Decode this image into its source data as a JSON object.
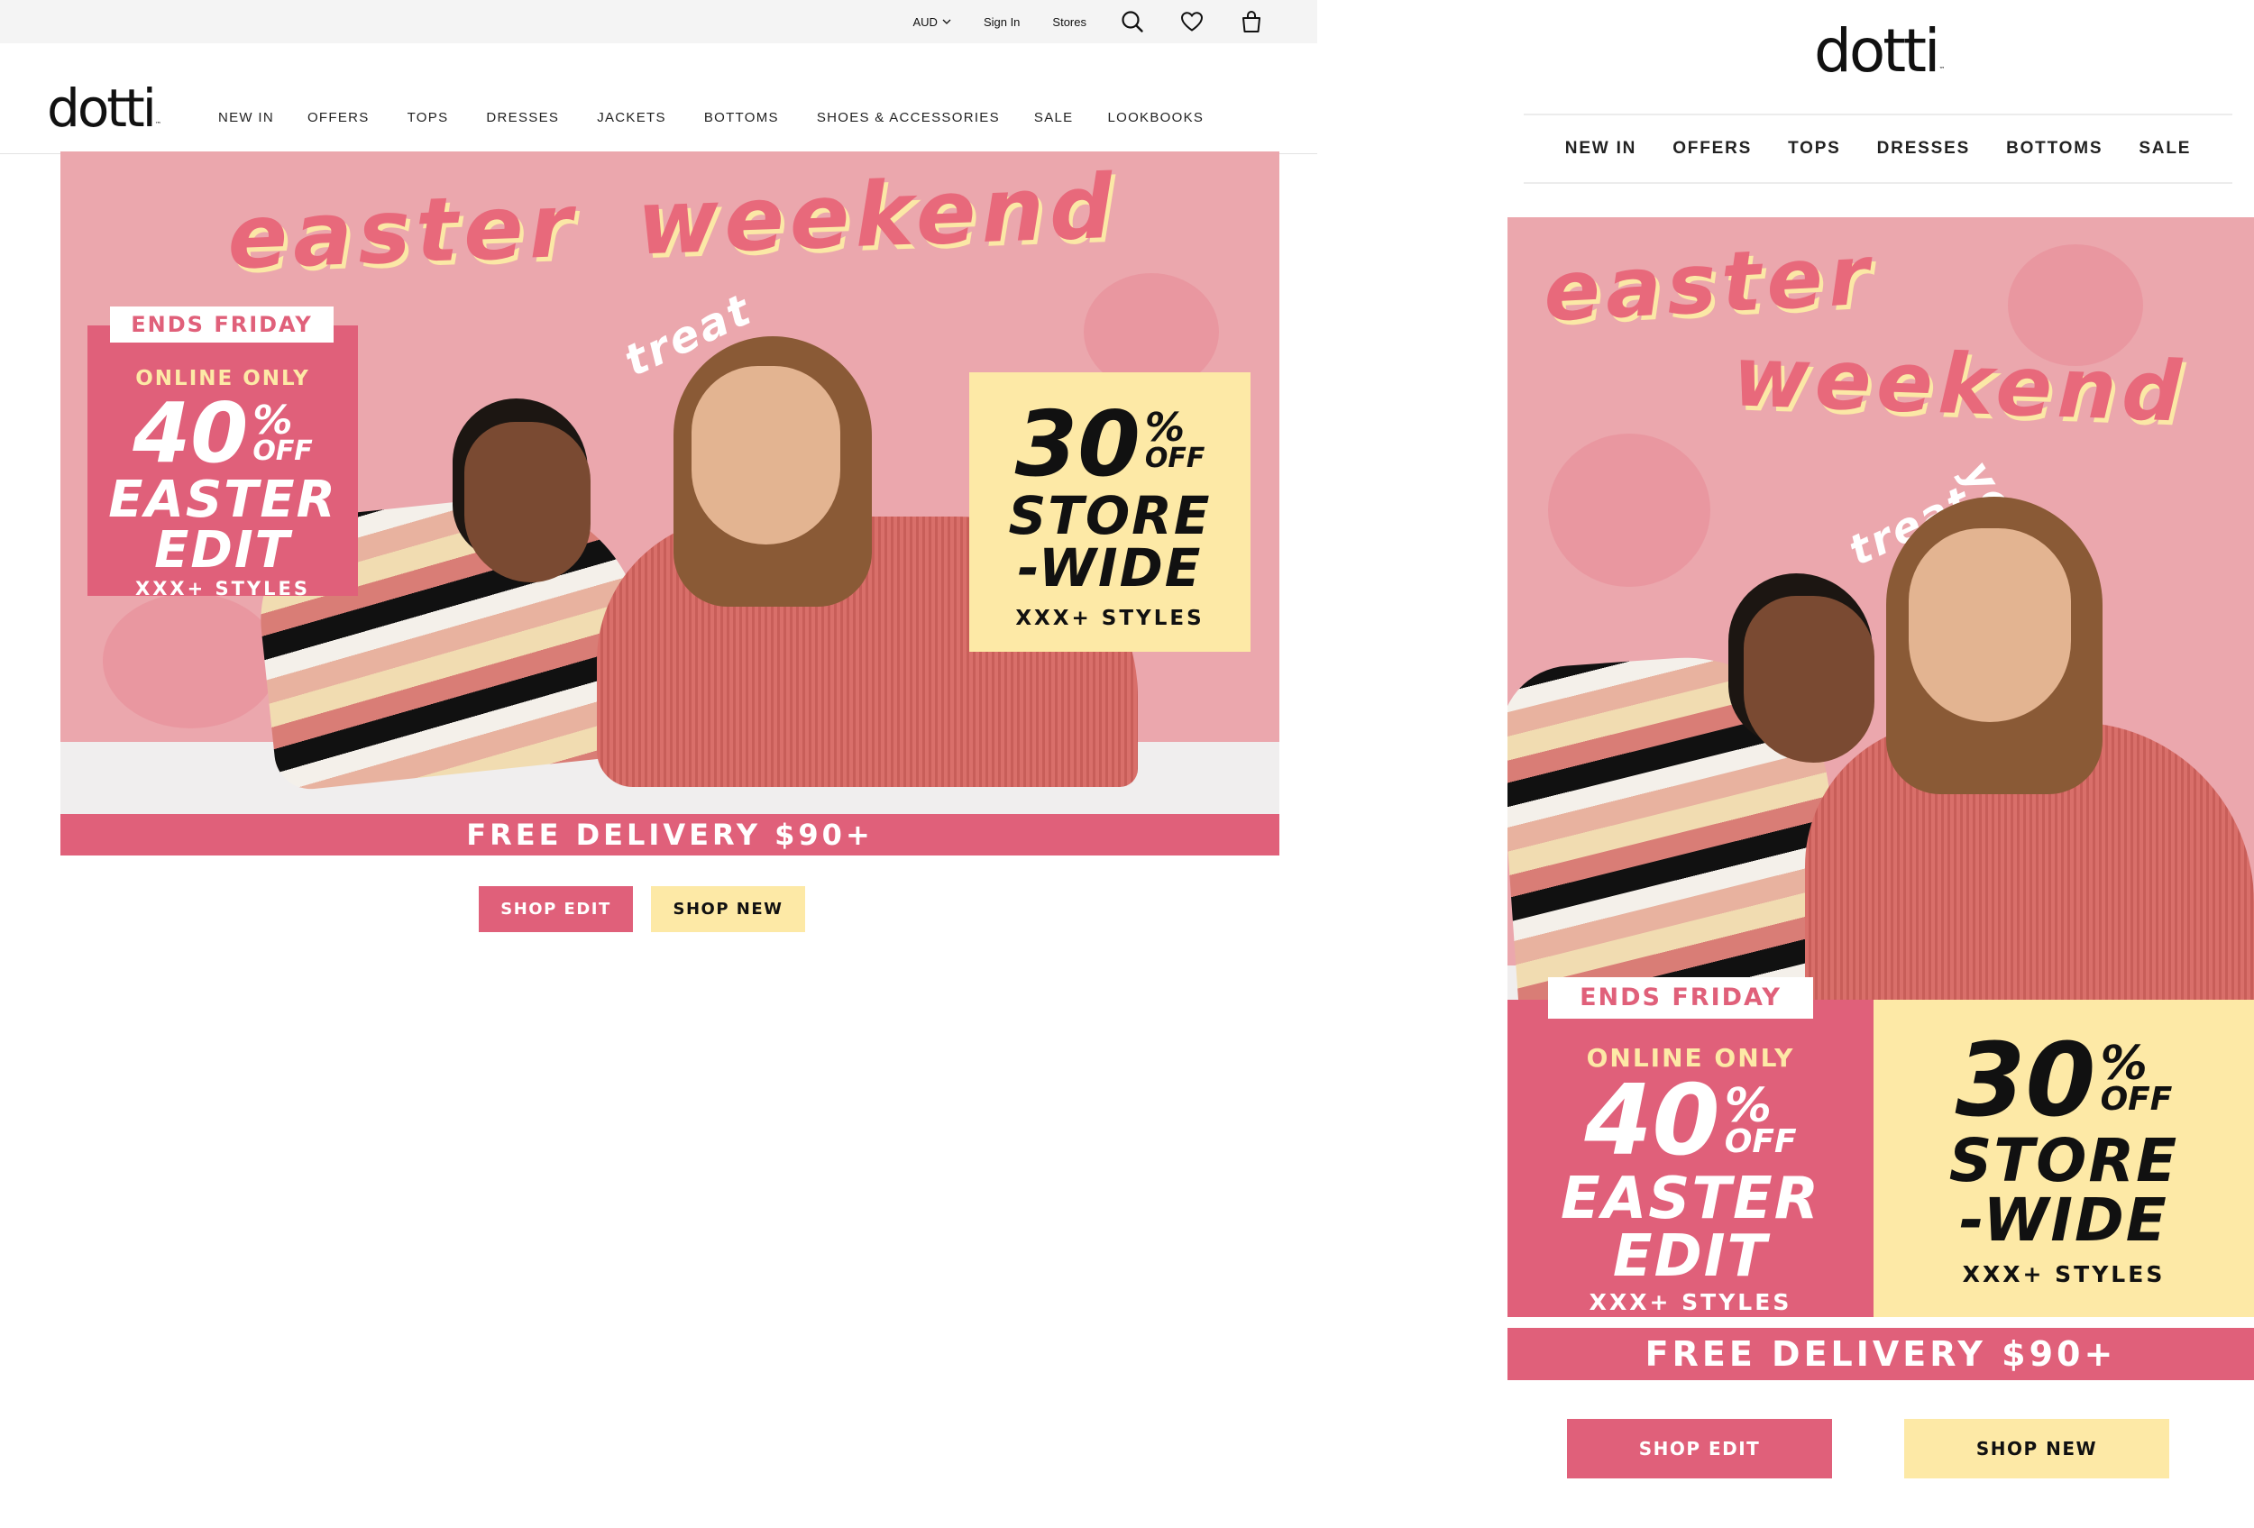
{
  "colors": {
    "brand_pink": "#e0607a",
    "hero_pink": "#eba7ad",
    "cream_yellow": "#fde9a6",
    "utility_bg": "#f4f4f4"
  },
  "desktop": {
    "utility": {
      "currency": "AUD",
      "sign_in": "Sign In",
      "stores": "Stores",
      "icons": [
        "search-icon",
        "heart-icon",
        "bag-icon"
      ]
    },
    "logo": "dotti",
    "nav": [
      "NEW IN",
      "OFFERS",
      "TOPS",
      "DRESSES",
      "JACKETS",
      "BOTTOMS",
      "SHOES & ACCESSORIES",
      "SALE",
      "LOOKBOOKS"
    ]
  },
  "mobile": {
    "logo": "dotti",
    "nav": [
      "NEW IN",
      "OFFERS",
      "TOPS",
      "DRESSES",
      "BOTTOMS",
      "SALE"
    ]
  },
  "hero": {
    "headline_line1": "easter",
    "headline_line2": "weekend",
    "treat": "treat",
    "yourself": "yourself",
    "ends": "ENDS FRIDAY",
    "online": "ONLINE ONLY",
    "pct_left": "40",
    "pct_right": "30",
    "pct_symbol": "%",
    "off": "OFF",
    "easter": "EASTER",
    "edit": "EDIT",
    "store": "STORE",
    "wide": "-WIDE",
    "styles": "XXX+ STYLES",
    "delivery": "FREE DELIVERY $90+"
  },
  "cta": {
    "shop_edit": "SHOP EDIT",
    "shop_new": "SHOP NEW"
  }
}
